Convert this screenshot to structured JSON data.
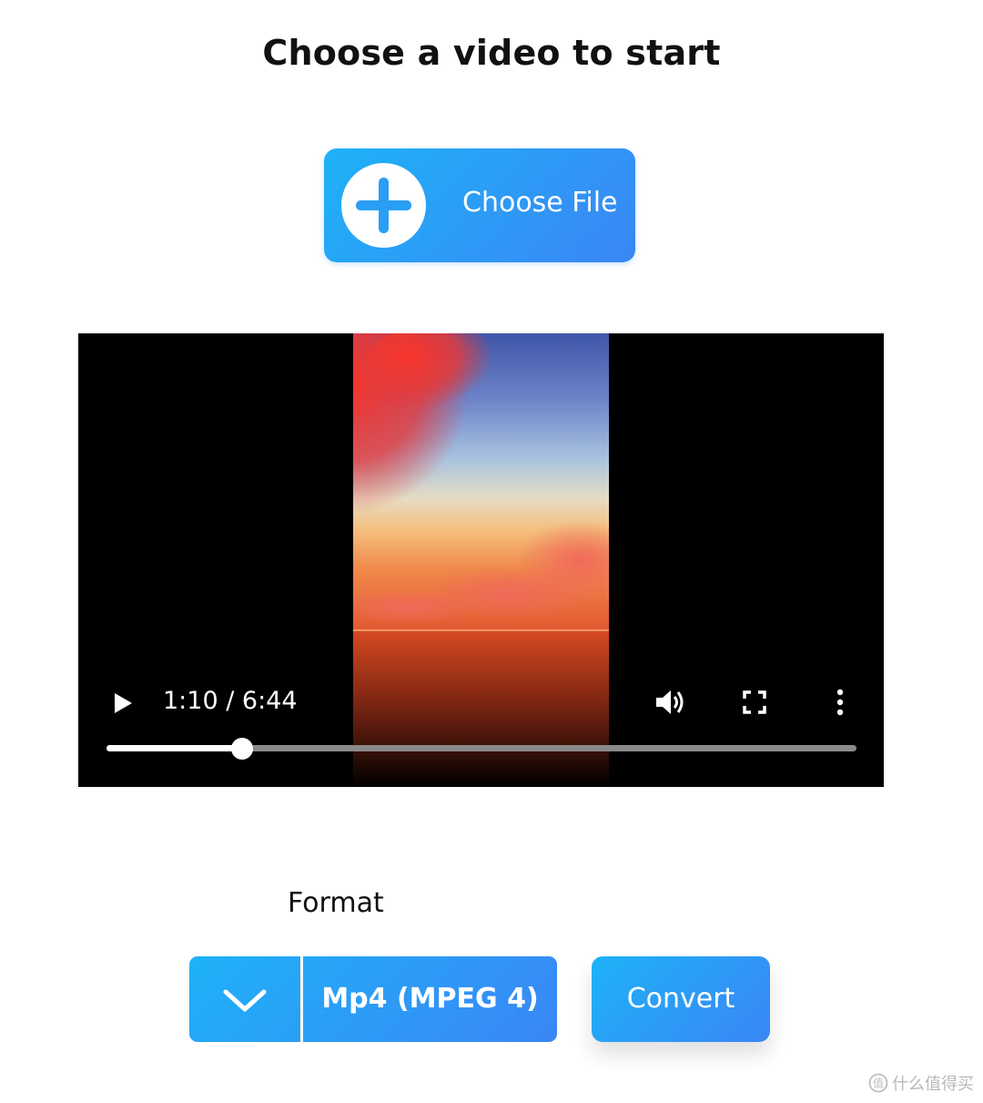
{
  "page": {
    "title": "Choose a video to start"
  },
  "file_picker": {
    "button_label": "Choose File",
    "icon": "plus-circle-icon"
  },
  "player": {
    "time_display": "1:10 / 6:44",
    "current_time": "1:10",
    "duration": "6:44",
    "progress_fraction": 0.181,
    "icons": {
      "play": "play-icon",
      "volume": "volume-icon",
      "fullscreen": "fullscreen-icon",
      "more": "more-vertical-icon"
    }
  },
  "format": {
    "label": "Format",
    "selected": "Mp4 (MPEG 4)",
    "icon": "chevron-down-icon"
  },
  "actions": {
    "convert_label": "Convert"
  },
  "watermark": {
    "text": "什么值得买"
  },
  "colors": {
    "accent_start": "#1eb2f7",
    "accent_end": "#3a86f5",
    "player_background": "#000000",
    "text_dark": "#111111"
  }
}
